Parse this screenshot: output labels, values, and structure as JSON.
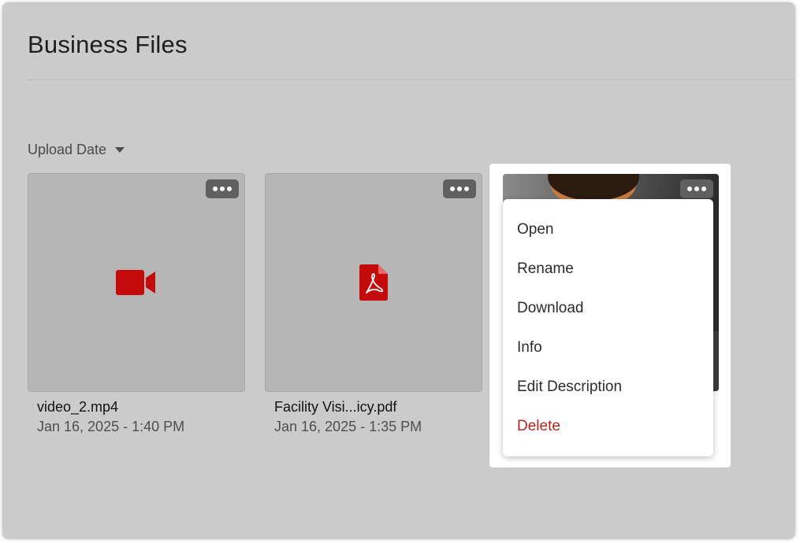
{
  "page": {
    "title": "Business Files"
  },
  "sort": {
    "label": "Upload Date"
  },
  "files": [
    {
      "name": "video_2.mp4",
      "date": "Jan 16, 2025 - 1:40 PM",
      "icon": "video-camera-icon"
    },
    {
      "name": "Facility Visi...icy.pdf",
      "date": "Jan 16, 2025 - 1:35 PM",
      "icon": "pdf-file-icon"
    },
    {
      "name": "",
      "date": "",
      "icon": "photo-thumbnail"
    }
  ],
  "context_menu": {
    "items": [
      "Open",
      "Rename",
      "Download",
      "Info",
      "Edit Description",
      "Delete"
    ]
  },
  "colors": {
    "background": "#cbcbcb",
    "file_icon_red": "#c40a0a",
    "delete_red": "#b3261e"
  }
}
